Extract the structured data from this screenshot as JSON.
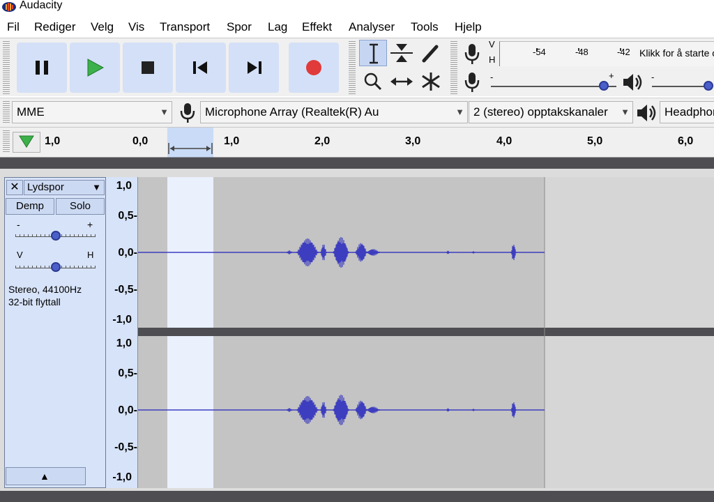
{
  "window": {
    "title": "Audacity"
  },
  "menu": [
    "Fil",
    "Rediger",
    "Velg",
    "Vis",
    "Transport",
    "Spor",
    "Lag",
    "Effekt",
    "Analyser",
    "Tools",
    "Hjelp"
  ],
  "transport": {
    "buttons": [
      {
        "name": "pause-icon"
      },
      {
        "name": "play-icon"
      },
      {
        "name": "stop-icon"
      },
      {
        "name": "skip-to-start-icon"
      },
      {
        "name": "skip-to-end-icon"
      },
      {
        "name": "record-icon"
      }
    ]
  },
  "tools": [
    "selection-tool-icon",
    "envelope-tool-icon",
    "draw-tool-icon",
    "zoom-tool-icon",
    "time-shift-tool-icon",
    "multi-tool-icon"
  ],
  "meter": {
    "labels_vh": [
      "V",
      "H"
    ],
    "ticks": [
      "-54",
      "-48",
      "-42"
    ],
    "prompt": "Klikk for å starte overvåking"
  },
  "mixer": {
    "rec_minus": "-",
    "rec_plus": "+",
    "rec_level": 0.9,
    "play_minus": "-",
    "play_level": 0.95
  },
  "devices": {
    "host": "MME",
    "mic": "Microphone Array (Realtek(R) Au",
    "channels": "2 (stereo) opptakskanaler",
    "output": "Headphones"
  },
  "timeline": {
    "labels": [
      "1,0",
      "0,0",
      "1,0",
      "2,0",
      "3,0",
      "4,0",
      "5,0",
      "6,0"
    ]
  },
  "track": {
    "name": "Lydspor",
    "mute": "Demp",
    "solo": "Solo",
    "gain_minus": "-",
    "gain_plus": "+",
    "gain_level": 0.5,
    "pan_left": "V",
    "pan_right": "H",
    "pan_level": 0.5,
    "info_line1": "Stereo, 44100Hz",
    "info_line2": "32-bit flyttall",
    "scale_labels": [
      "1,0",
      "0,5-",
      "0,0-",
      "-0,5-",
      "-1,0"
    ]
  },
  "colors": {
    "accent": "#4a5fc9",
    "play": "#3cb04a",
    "record": "#e03a3a",
    "button_bg": "#d4e0f7",
    "waveform": "#3d3dbf"
  }
}
